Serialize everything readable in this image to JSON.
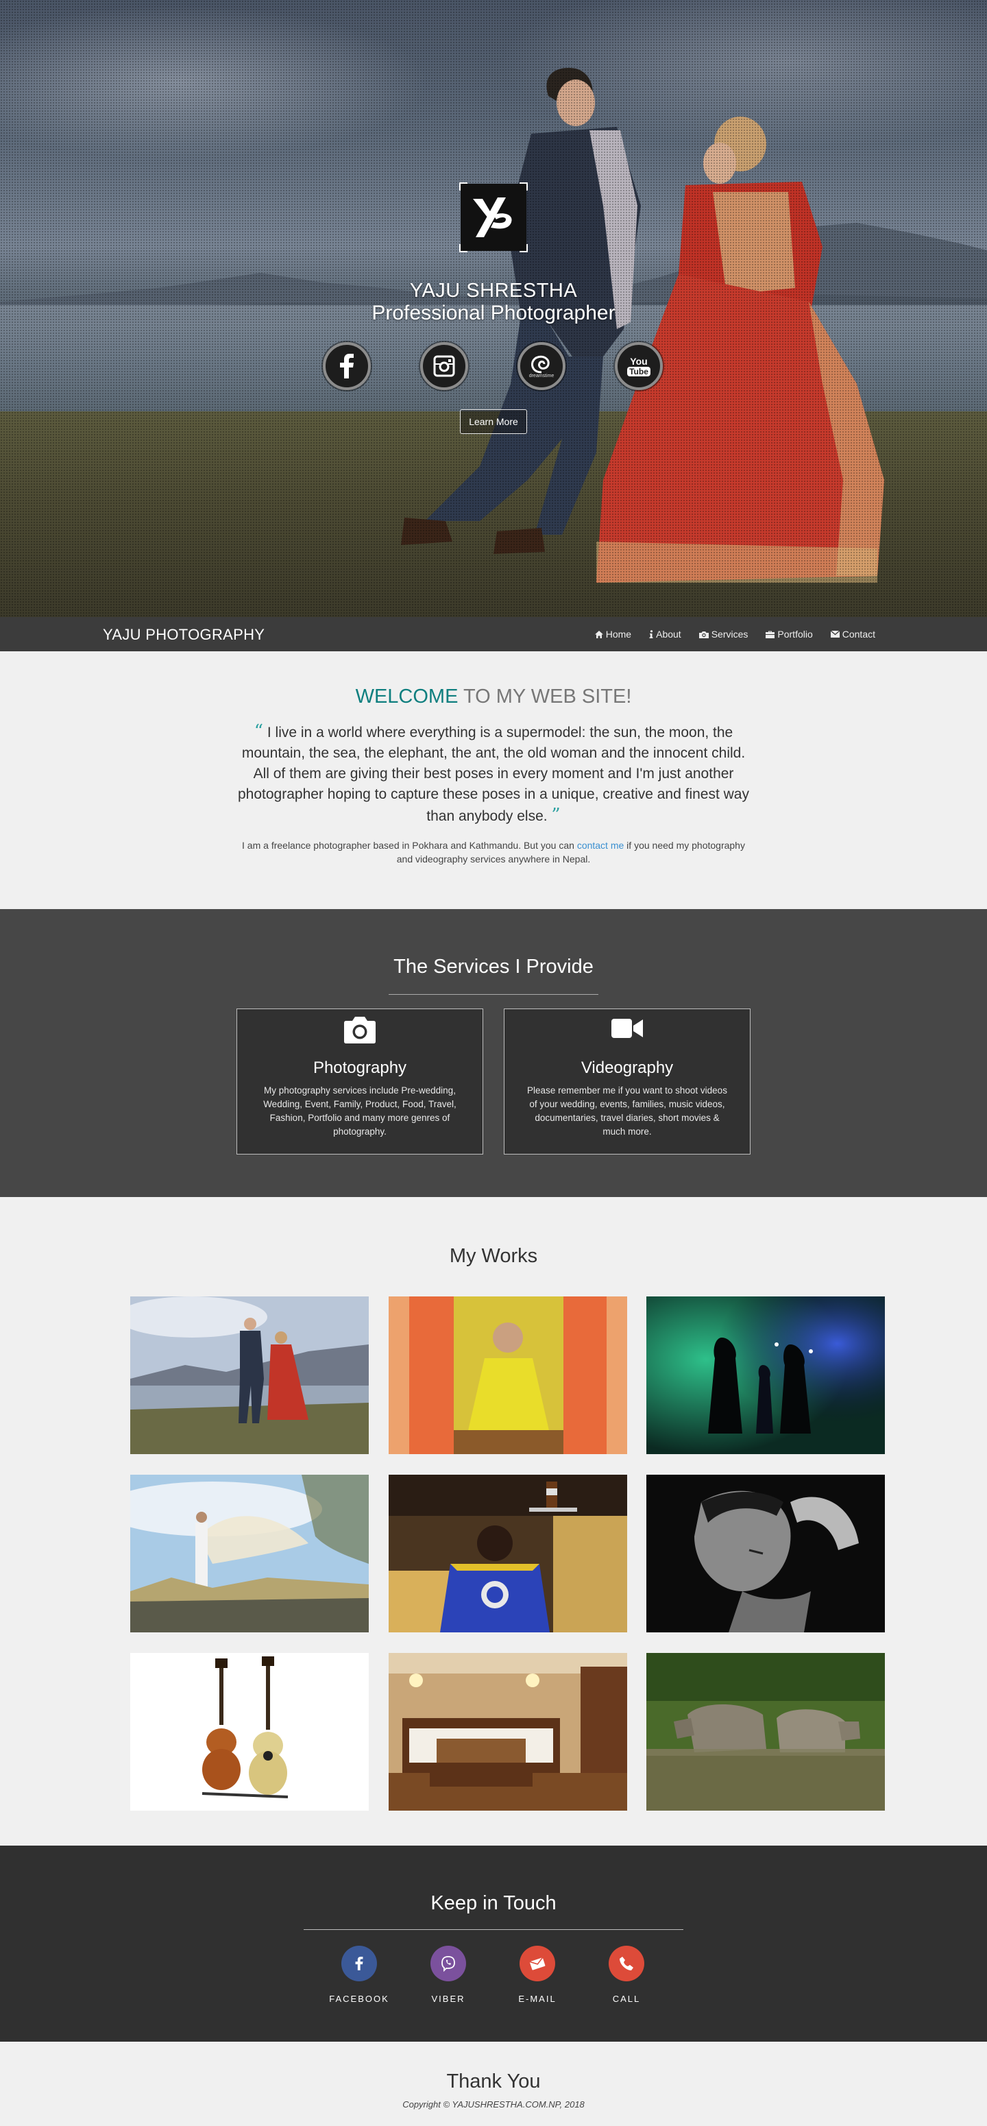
{
  "hero": {
    "name": "YAJU SHRESTHA",
    "subtitle": "Professional Photographer",
    "logo_icon": "yp-monogram-logo",
    "social": [
      {
        "name": "facebook",
        "icon": "facebook-icon"
      },
      {
        "name": "instagram",
        "icon": "instagram-icon"
      },
      {
        "name": "dreamstime",
        "icon": "dreamstime-icon",
        "label": "dreamstime"
      },
      {
        "name": "youtube",
        "icon": "youtube-icon",
        "label": "You Tube"
      }
    ],
    "cta_label": "Learn More"
  },
  "navbar": {
    "brand": "YAJU PHOTOGRAPHY",
    "items": [
      {
        "label": "Home",
        "icon": "home-icon"
      },
      {
        "label": "About",
        "icon": "info-icon"
      },
      {
        "label": "Services",
        "icon": "camera-icon"
      },
      {
        "label": "Portfolio",
        "icon": "briefcase-icon"
      },
      {
        "label": "Contact",
        "icon": "envelope-icon"
      }
    ]
  },
  "welcome": {
    "title_accent": "WELCOME",
    "title_rest": " TO MY WEB SITE!",
    "open_quote": "“",
    "close_quote": "”",
    "quote": "I live in a world where everything is a supermodel: the sun, the moon, the mountain, the sea, the elephant, the ant, the old woman and the innocent child. All of them are giving their best poses in every moment and I'm just another photographer hoping to capture these poses in a unique, creative and finest way than anybody else.",
    "about_before": "I am a freelance photographer based in Pokhara and Kathmandu. But you can ",
    "about_link": "contact me",
    "about_after": " if you need my photography and videography services anywhere in Nepal."
  },
  "services": {
    "title": "The Services I Provide",
    "items": [
      {
        "title": "Photography",
        "icon": "camera-icon",
        "description": "My photography services include Pre-wedding, Wedding, Event, Family, Product, Food, Travel, Fashion, Portfolio and many more genres of photography."
      },
      {
        "title": "Videography",
        "icon": "video-camera-icon",
        "description": "Please remember me if you want to shoot videos of your wedding, events, families, music videos, documentaries, travel diaries, short movies & much more."
      }
    ]
  },
  "works": {
    "title": "My Works",
    "thumbnails": [
      "prewedding-lake-couple",
      "smiling-woman-yellow",
      "silhouette-couple-lights",
      "woman-white-veil",
      "waiter-serving-glasses",
      "woman-black-and-white",
      "two-guitars",
      "hotel-bedroom",
      "rhinos-in-water"
    ]
  },
  "contact": {
    "title": "Keep in Touch",
    "items": [
      {
        "label": "FACEBOOK",
        "icon": "facebook-icon",
        "color": "#3b5998"
      },
      {
        "label": "VIBER",
        "icon": "viber-icon",
        "color": "#7b519d"
      },
      {
        "label": "E-MAIL",
        "icon": "email-icon",
        "color": "#dd4b39"
      },
      {
        "label": "CALL",
        "icon": "phone-icon",
        "color": "#dd4b39"
      }
    ]
  },
  "footer": {
    "thanks": "Thank You",
    "copyright": "Copyright © YAJUSHRESTHA.COM.NP, 2018"
  },
  "colors": {
    "accent": "#0f7f7f",
    "link": "#3a8fd0",
    "navbar": "#3c3c3c",
    "services_bg": "#474747",
    "contact_bg": "#303030"
  }
}
